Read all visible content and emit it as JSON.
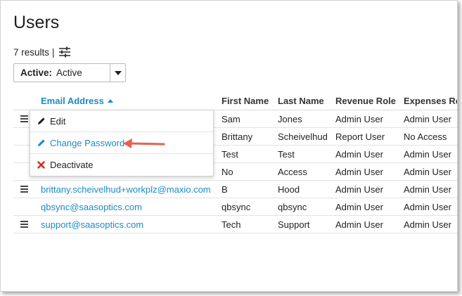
{
  "page": {
    "title": "Users"
  },
  "results": {
    "count_text": "7 results",
    "separator": "|"
  },
  "status_filter": {
    "label": "Active:",
    "value": "Active"
  },
  "table": {
    "columns": [
      {
        "key": "email",
        "label": "Email Address"
      },
      {
        "key": "first",
        "label": "First Name"
      },
      {
        "key": "last",
        "label": "Last Name"
      },
      {
        "key": "revenue",
        "label": "Revenue Role"
      },
      {
        "key": "expenses",
        "label": "Expenses Ro"
      }
    ],
    "rows": [
      {
        "email": "",
        "first": "Sam",
        "last": "Jones",
        "revenue": "Admin User",
        "expenses": "Admin User",
        "menu": true
      },
      {
        "email": "",
        "first": "Brittany",
        "last": "Scheivelhud",
        "revenue": "Report User",
        "expenses": "No Access",
        "menu": false
      },
      {
        "email": "",
        "first": "Test",
        "last": "Test",
        "revenue": "Admin User",
        "expenses": "Admin User",
        "menu": false
      },
      {
        "email": "",
        "first": "No",
        "last": "Access",
        "revenue": "Admin User",
        "expenses": "Admin User",
        "menu": false
      },
      {
        "email": "brittany.scheivelhud+workplz@maxio.com",
        "first": "B",
        "last": "Hood",
        "revenue": "Admin User",
        "expenses": "Admin User",
        "menu": true
      },
      {
        "email": "qbsync@saasoptics.com",
        "first": "qbsync",
        "last": "qbsync",
        "revenue": "Admin User",
        "expenses": "Admin User",
        "menu": false
      },
      {
        "email": "support@saasoptics.com",
        "first": "Tech",
        "last": "Support",
        "revenue": "Admin User",
        "expenses": "Admin User",
        "menu": true
      }
    ]
  },
  "row_menu": {
    "items": [
      {
        "label": "Edit",
        "icon": "pencil-icon"
      },
      {
        "label": "Change Password",
        "icon": "pencil-icon"
      },
      {
        "label": "Deactivate",
        "icon": "x-icon"
      }
    ]
  },
  "colors": {
    "link": "#1b8bc6",
    "annotation_arrow": "#e8604c",
    "deactivate_x": "#d9261c"
  }
}
